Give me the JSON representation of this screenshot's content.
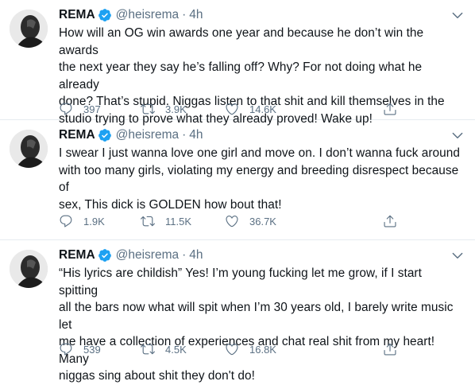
{
  "colors": {
    "text": "#0f1419",
    "secondary": "#5b7083",
    "verified": "#1da1f2",
    "divider": "#e6ecf0"
  },
  "tweets": [
    {
      "name": "REMA",
      "handle": "@heisrema",
      "separator": "·",
      "time": "4h",
      "lines": [
        "How will an OG win awards one year and because he don’t win the awards",
        "the next year they say he’s falling off? Why? For not doing what he already",
        "done? That’s stupid. Niggas listen to that shit and kill themselves in the",
        "studio trying to prove what they already proved! Wake up!"
      ],
      "replies": "397",
      "retweets": "3.9K",
      "likes": "14.6K"
    },
    {
      "name": "REMA",
      "handle": "@heisrema",
      "separator": "·",
      "time": "4h",
      "lines": [
        "I swear I just wanna love one girl and move on. I don’t wanna fuck around",
        "with too many girls, violating my energy and breeding disrespect because of",
        "sex, This dick is GOLDEN how bout that!"
      ],
      "replies": "1.9K",
      "retweets": "11.5K",
      "likes": "36.7K"
    },
    {
      "name": "REMA",
      "handle": "@heisrema",
      "separator": "·",
      "time": "4h",
      "lines": [
        "“His lyrics are childish” Yes! I’m young fucking let me grow, if I start spitting",
        "all the bars now what will spit when I’m 30 years old, I barely write music let",
        "me have a collection of experiences and chat real shit from my heart! Many",
        "niggas sing about shit they don't do!"
      ],
      "replies": "539",
      "retweets": "4.5K",
      "likes": "16.8K"
    }
  ]
}
